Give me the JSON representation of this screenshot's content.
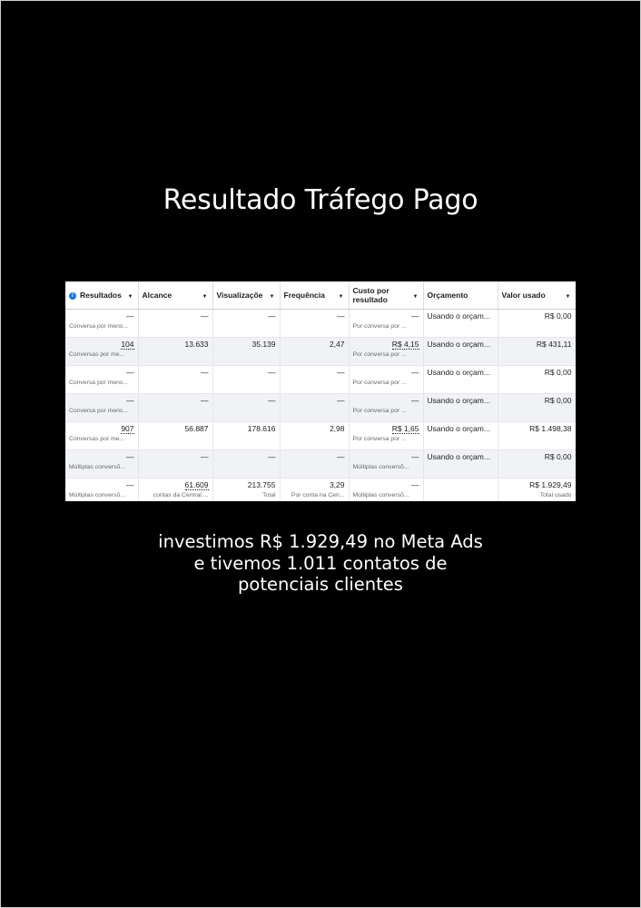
{
  "title": "Resultado Tráfego Pago",
  "table": {
    "headers": [
      "Resultados",
      "Alcance",
      "Visualizaçõe",
      "Frequência",
      "Custo por resultado",
      "Orçamento",
      "Valor usado"
    ],
    "rows": [
      {
        "resultados": "—",
        "resultados_sub": "Conversa por mens...",
        "alcance": "—",
        "visualizacoes": "—",
        "frequencia": "—",
        "custo": "—",
        "custo_sub": "Por conversa por ...",
        "orcamento": "Usando o orçam...",
        "valor": "R$ 0,00"
      },
      {
        "resultados": "104",
        "resultados_sub": "Conversas por me...",
        "alcance": "13.633",
        "visualizacoes": "35.139",
        "frequencia": "2,47",
        "custo": "R$ 4,15",
        "custo_sub": "Por conversa por ...",
        "orcamento": "Usando o orçam...",
        "valor": "R$ 431,11"
      },
      {
        "resultados": "—",
        "resultados_sub": "Conversa por mens...",
        "alcance": "—",
        "visualizacoes": "—",
        "frequencia": "—",
        "custo": "—",
        "custo_sub": "Por conversa por ...",
        "orcamento": "Usando o orçam...",
        "valor": "R$ 0,00"
      },
      {
        "resultados": "—",
        "resultados_sub": "Conversa por mens...",
        "alcance": "—",
        "visualizacoes": "—",
        "frequencia": "—",
        "custo": "—",
        "custo_sub": "Por conversa por ...",
        "orcamento": "Usando o orçam...",
        "valor": "R$ 0,00"
      },
      {
        "resultados": "907",
        "resultados_sub": "Conversas por me...",
        "alcance": "56.887",
        "visualizacoes": "178.616",
        "frequencia": "2,98",
        "custo": "R$ 1,65",
        "custo_sub": "Por conversa por ...",
        "orcamento": "Usando o orçam...",
        "valor": "R$ 1.498,38"
      },
      {
        "resultados": "—",
        "resultados_sub": "Múltiplas conversõ...",
        "alcance": "—",
        "visualizacoes": "—",
        "frequencia": "—",
        "custo": "—",
        "custo_sub": "Múltiplas conversõ...",
        "orcamento": "Usando o orçam...",
        "valor": "R$ 0,00"
      }
    ],
    "totals": {
      "resultados": "—",
      "resultados_sub": "Múltiplas conversõ...",
      "alcance": "61.609",
      "alcance_sub": "contas da Central ...",
      "visualizacoes": "213.755",
      "visualizacoes_sub": "Total",
      "frequencia": "3,29",
      "frequencia_sub": "Por conta na Cen...",
      "custo": "—",
      "custo_sub": "Múltiplas conversõ...",
      "orcamento": "",
      "valor": "R$ 1.929,49",
      "valor_sub": "Total usado"
    }
  },
  "caption": {
    "line1": "investimos R$ 1.929,49 no Meta Ads",
    "line2": "e tivemos 1.011 contatos de",
    "line3": "potenciais clientes"
  }
}
